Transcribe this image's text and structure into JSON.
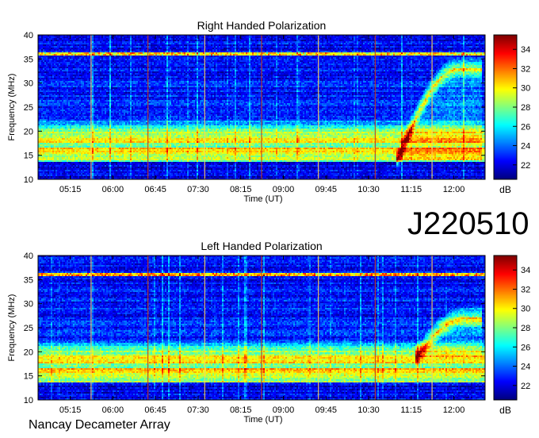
{
  "observation_id": "J220510",
  "footer": "Nancay Decameter Array",
  "chart_data": [
    {
      "type": "heatmap",
      "title": "Right Handed Polarization",
      "xlabel": "Time (UT)",
      "ylabel": "Frequency (MHz)",
      "x_tick_labels": [
        "05:15",
        "06:00",
        "06:45",
        "07:30",
        "08:15",
        "09:00",
        "09:45",
        "10:30",
        "11:15",
        "12:00"
      ],
      "y_ticks": [
        10,
        15,
        20,
        25,
        30,
        35,
        40
      ],
      "ylim": [
        10,
        40
      ],
      "colorbar": {
        "label": "dB",
        "ticks": [
          22,
          24,
          26,
          28,
          30,
          32,
          34
        ],
        "range": [
          20.5,
          35.5
        ],
        "colormap": "jet"
      },
      "time_markers": [
        "05:37",
        "06:37",
        "07:37",
        "08:37",
        "09:37",
        "10:37",
        "11:37"
      ],
      "intense_bands_mhz": [
        [
          13.5,
          20.5
        ]
      ],
      "burst_features": [
        {
          "time_start": "11:00",
          "time_end": "12:30",
          "freq_start": 14,
          "freq_end": 33,
          "polarization": "right"
        }
      ]
    },
    {
      "type": "heatmap",
      "title": "Left Handed Polarization",
      "xlabel": "Time (UT)",
      "ylabel": "Frequency (MHz)",
      "x_tick_labels": [
        "05:15",
        "06:00",
        "06:45",
        "07:30",
        "08:15",
        "09:00",
        "09:45",
        "10:30",
        "11:15",
        "12:00"
      ],
      "y_ticks": [
        10,
        15,
        20,
        25,
        30,
        35,
        40
      ],
      "ylim": [
        10,
        40
      ],
      "colorbar": {
        "label": "dB",
        "ticks": [
          22,
          24,
          26,
          28,
          30,
          32,
          34
        ],
        "range": [
          20.5,
          35.5
        ],
        "colormap": "jet"
      },
      "time_markers": [
        "05:37",
        "06:37",
        "07:37",
        "08:37",
        "09:37",
        "10:37",
        "11:37"
      ],
      "intense_bands_mhz": [
        [
          13.5,
          20.5
        ]
      ],
      "burst_features": [
        {
          "time_start": "11:20",
          "time_end": "12:30",
          "freq_start": 19,
          "freq_end": 27,
          "polarization": "left"
        }
      ]
    }
  ]
}
